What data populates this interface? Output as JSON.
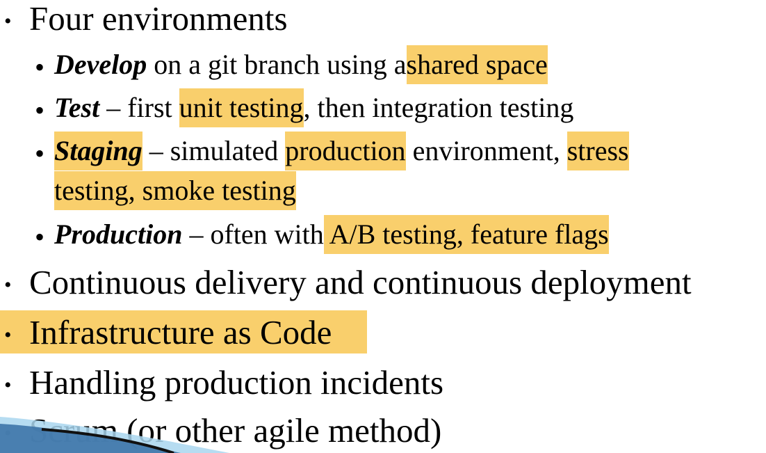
{
  "items": [
    {
      "bullet": "•",
      "text": "Four environments"
    },
    {
      "bullet": "•",
      "term": "Develop",
      "text_a": " on a git branch using a",
      "hl": "shared space"
    },
    {
      "bullet": "•",
      "term": "Test",
      "text_a": " – first ",
      "hl": "unit testing",
      "text_b": ", then integration testing"
    },
    {
      "bullet": "•",
      "term": "Staging",
      "text_a": " – simulated ",
      "hl": "production",
      "text_b": " environment, ",
      "hl2": "stress",
      "hl3": "testing, smoke testing"
    },
    {
      "bullet": "•",
      "term": "Production",
      "text_a": " – often with",
      "hl": " A/B testing, feature flags"
    },
    {
      "bullet": "•",
      "text": "Continuous delivery and continuous deployment"
    },
    {
      "bullet": "•",
      "text": "Infrastructure as Code"
    },
    {
      "bullet": "•",
      "text": "Handling production incidents"
    },
    {
      "bullet": "•",
      "text": "Scrum (or other agile method)"
    }
  ],
  "colors": {
    "highlight": "#f9cf6c",
    "text": "#000000",
    "deco_blue": "#3d74a8",
    "deco_light": "#a9d6ee"
  }
}
